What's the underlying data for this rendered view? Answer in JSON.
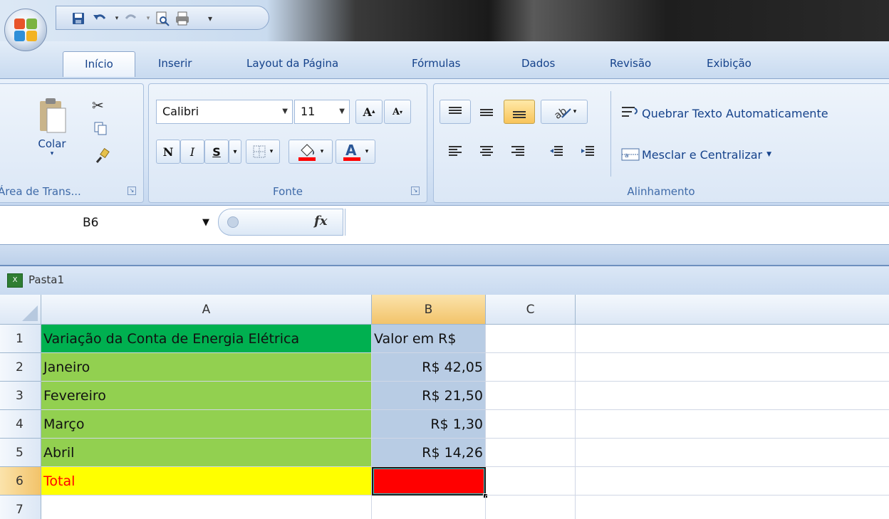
{
  "ribbon_tabs": [
    "Início",
    "Inserir",
    "Layout da Página",
    "Fórmulas",
    "Dados",
    "Revisão",
    "Exibição"
  ],
  "clipboard": {
    "paste_label": "Colar",
    "group_label": "Área de Trans..."
  },
  "font": {
    "name": "Calibri",
    "size": "11",
    "bold": "N",
    "italic": "I",
    "underline": "S",
    "group_label": "Fonte"
  },
  "alignment": {
    "wrap_text": "Quebrar Texto Automaticamente",
    "merge_center": "Mesclar e Centralizar",
    "group_label": "Alinhamento"
  },
  "formula_bar": {
    "name_box": "B6",
    "fx": "fx",
    "formula": ""
  },
  "workbook": {
    "title": "Pasta1"
  },
  "columns": [
    "A",
    "B",
    "C"
  ],
  "rows": [
    "1",
    "2",
    "3",
    "4",
    "5",
    "6",
    "7"
  ],
  "cells": {
    "A1": "Variação da Conta de Energia Elétrica",
    "B1": "Valor em R$",
    "A2": "Janeiro",
    "B2": "R$ 42,05",
    "A3": "Fevereiro",
    "B3": "R$ 21,50",
    "A4": "Março",
    "B4": "R$ 1,30",
    "A5": "Abril",
    "B5": "R$ 14,26",
    "A6": "Total",
    "B6": ""
  },
  "colors": {
    "header_green": "#00b050",
    "data_green": "#92d050",
    "value_blue": "#b8cce4",
    "total_yellow": "#ffff00",
    "selected_red": "#ff0000",
    "total_text": "#ff0000"
  }
}
